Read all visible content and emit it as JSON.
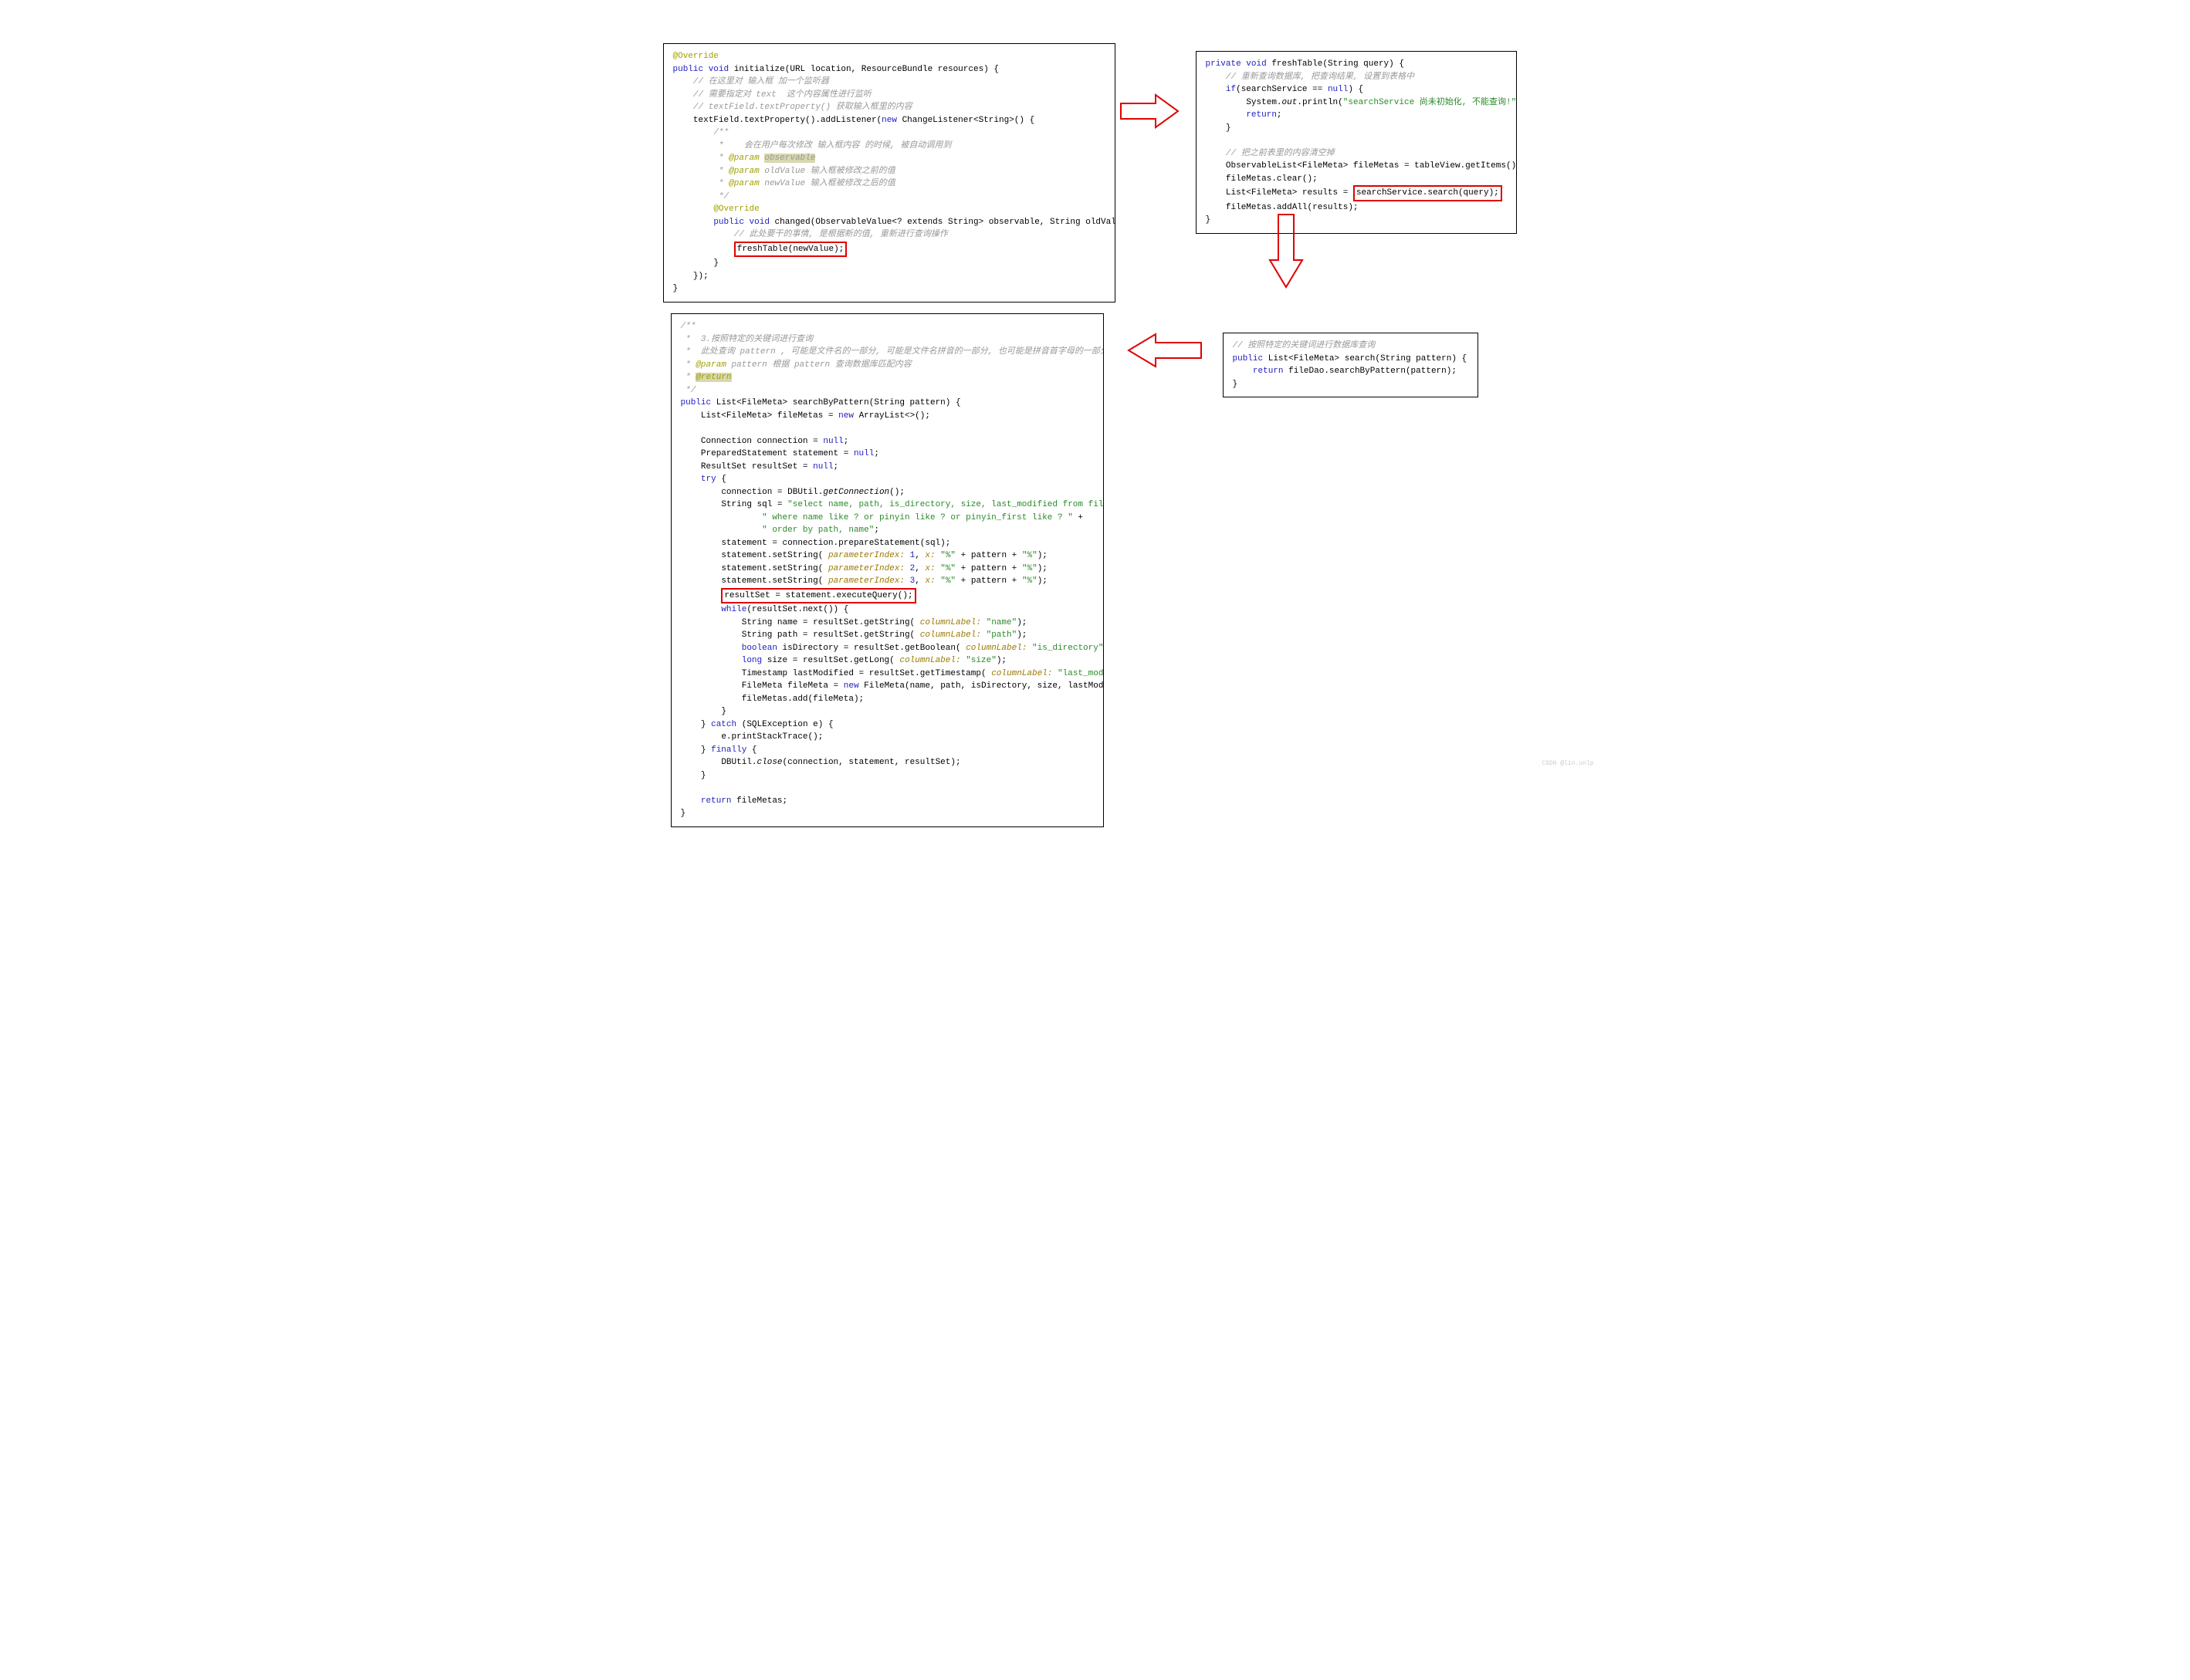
{
  "watermark": "CSDN @lin.unlp",
  "box1": {
    "l1": "@Override",
    "l2a": "public void",
    "l2b": "initialize(URL location, ResourceBundle resources) {",
    "l3": "// 在这里对 输入框 加一个监听器",
    "l4": "// 需要指定对 text  这个内容属性进行监听",
    "l5": "// textField.textProperty() 获取输入框里的内容",
    "l6a": "textField.textProperty().addListener(",
    "l6b": "new",
    "l6c": " ChangeListener<String>() {",
    "l7": "/**",
    "l8": " *    会在用户每次修改 输入框内容 的时候, 被自动调用到",
    "l9a": "@param",
    "l9b": "observable",
    "l10a": "@param",
    "l10b": "oldValue 输入框被修改之前的值",
    "l11a": "@param",
    "l11b": "newValue 输入框被修改之后的值",
    "l12": " */",
    "l13": "@Override",
    "l14a": "public void",
    "l14b": "changed(ObservableValue<? extends String> observable, String oldValue, String newValue) {",
    "l15": "// 此处要干的事情, 是根据新的值, 重新进行查询操作",
    "l16": "freshTable(newValue);",
    "l17": "}",
    "l18": "});",
    "l19": "}"
  },
  "box2": {
    "l1a": "private void",
    "l1b": "freshTable(String query) {",
    "l2": "// 重新查询数据库, 把查询结果, 设置到表格中",
    "l3a": "if",
    "l3b": "(searchService == ",
    "l3c": "null",
    "l3d": ") {",
    "l4a": "System.",
    "l4b": "out",
    "l4c": ".println(",
    "l4d": "\"searchService 尚未初始化, 不能查询!\"",
    "l4e": ");",
    "l5": "return",
    "l6": "}",
    "l7": "// 把之前表里的内容清空掉",
    "l8": "ObservableList<FileMeta> fileMetas = tableView.getItems();",
    "l9": "fileMetas.clear();",
    "l10a": "List<FileMeta> results = ",
    "l10b": "searchService.search(query);",
    "l11": "fileMetas.addAll(results);",
    "l12": "}"
  },
  "box3": {
    "l1": "// 按照特定的关键词进行数据库查询",
    "l2a": "public",
    "l2b": "List<FileMeta> search(String pattern) {",
    "l3a": "return",
    "l3b": "fileDao.searchByPattern(pattern);",
    "l4": "}"
  },
  "box4": {
    "c1": "/**",
    "c2": " *  3.按照特定的关键词进行查询",
    "c3": " *  此处查询 pattern , 可能是文件名的一部分, 可能是文件名拼音的一部分, 也可能是拼音首字母的一部分 ...",
    "c4a": "@param",
    "c4b": "pattern 根据 pattern 查询数据库匹配内容",
    "c5": "@return",
    "c6": " */",
    "l1a": "public",
    "l1b": "List<FileMeta> searchByPattern(String pattern) {",
    "l2a": "List<FileMeta> fileMetas = ",
    "l2b": "new",
    "l2c": "ArrayList<>();",
    "l3a": "Connection connection = ",
    "l3b": "null",
    "l3c": ";",
    "l4a": "PreparedStatement statement = ",
    "l4b": "null",
    "l4c": ";",
    "l5a": "ResultSet resultSet = ",
    "l5b": "null",
    "l5c": ";",
    "l6": "try",
    "l7a": "connection = DBUtil.",
    "l7b": "getConnection",
    "l7c": "();",
    "l8a": "String sql = ",
    "l8b": "\"select name, path, is_directory, size, last_modified from file_meta \"",
    "l8c": " +",
    "l9": "\" where name like ? or pinyin like ? or pinyin_first like ? \"",
    "l10": "\" order by path, name\"",
    "l11": "statement = connection.prepareStatement(sql);",
    "l12a": "statement.setString(",
    "l12b": "parameterIndex:",
    "l12c": "1",
    "l12d": ",",
    "l12e": "x:",
    "l12f": "\"%\"",
    "l12g": "+ pattern +",
    "l12h": "\"%\"",
    "l12i": ");",
    "l13a": "statement.setString(",
    "l13b": "parameterIndex:",
    "l13c": "2",
    "l13d": ",",
    "l13e": "x:",
    "l13f": "\"%\"",
    "l13g": "+ pattern +",
    "l13h": "\"%\"",
    "l13i": ");",
    "l14a": "statement.setString(",
    "l14b": "parameterIndex:",
    "l14c": "3",
    "l14d": ",",
    "l14e": "x:",
    "l14f": "\"%\"",
    "l14g": "+ pattern +",
    "l14h": "\"%\"",
    "l14i": ");",
    "l15": "resultSet = statement.executeQuery();",
    "l16a": "while",
    "l16b": "(resultSet.next()) {",
    "l17a": "String name = resultSet.getString(",
    "l17b": "columnLabel:",
    "l17c": "\"name\"",
    "l17d": ");",
    "l18a": "String path = resultSet.getString(",
    "l18b": "columnLabel:",
    "l18c": "\"path\"",
    "l18d": ");",
    "l19a": "boolean",
    "l19b": "isDirectory = resultSet.getBoolean(",
    "l19c": "columnLabel:",
    "l19d": "\"is_directory\"",
    "l19e": ");",
    "l20a": "long",
    "l20b": "size = resultSet.getLong(",
    "l20c": "columnLabel:",
    "l20d": "\"size\"",
    "l20e": ");",
    "l21a": "Timestamp lastModified = resultSet.getTimestamp(",
    "l21b": "columnLabel:",
    "l21c": "\"last_modified\"",
    "l21d": ");",
    "l22a": "FileMeta fileMeta = ",
    "l22b": "new",
    "l22c": "FileMeta(name, path, isDirectory, size, lastModified.getTime());",
    "l23": "fileMetas.add(fileMeta);",
    "l24": "}",
    "l25a": "} ",
    "l25b": "catch",
    "l25c": " (SQLException e) {",
    "l26": "e.printStackTrace();",
    "l27a": "} ",
    "l27b": "finally",
    "l27c": " {",
    "l28a": "DBUtil.",
    "l28b": "close",
    "l28c": "(connection, statement, resultSet);",
    "l29": "}",
    "l30a": "return",
    "l30b": "fileMetas;",
    "l31": "}"
  }
}
